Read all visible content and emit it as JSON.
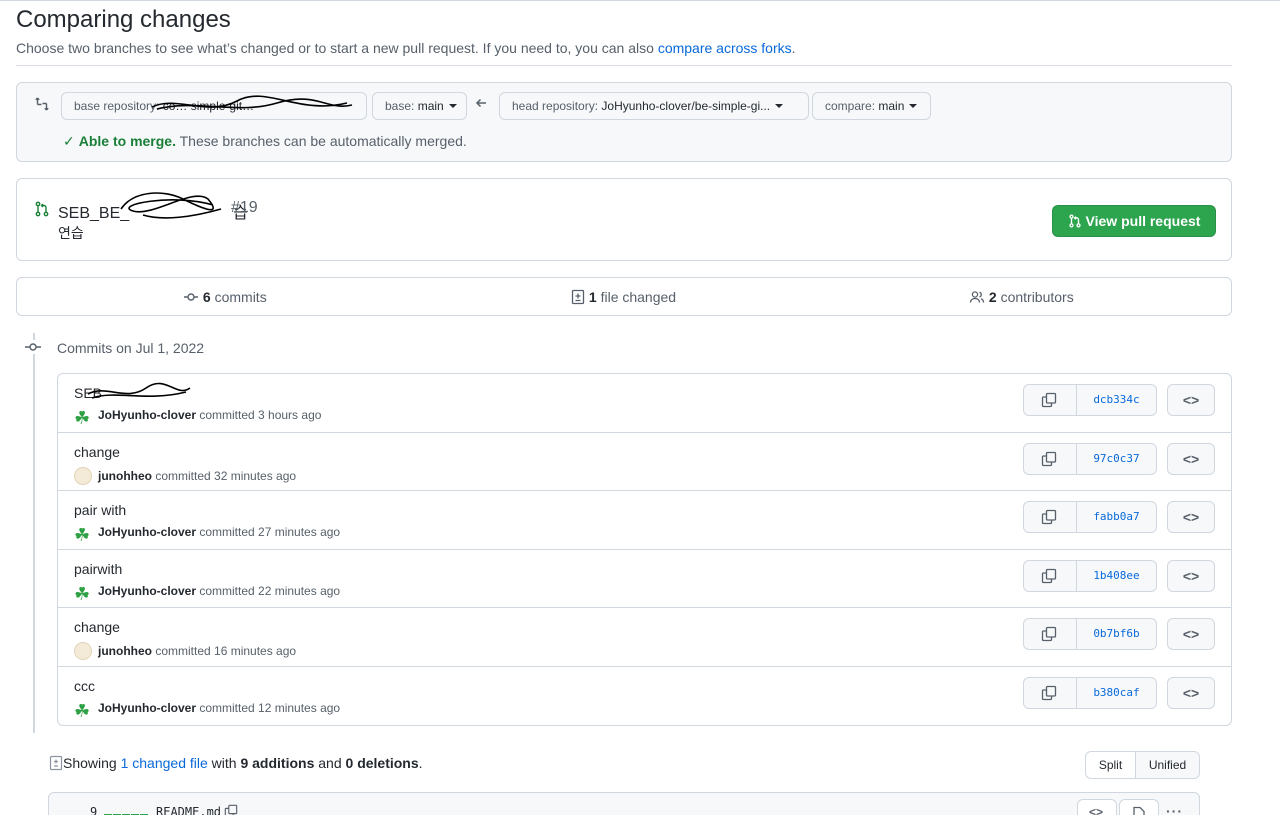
{
  "page": {
    "title": "Comparing changes",
    "subtitle": "Choose two branches to see what’s changed or to start a new pull request. If you need to, you can also ",
    "subtitle_link": "compare across forks",
    "subtitle_end": "."
  },
  "range": {
    "base_repo_label": "base repository: ",
    "base_repo_value": "co… simple-git…",
    "base_label": "base: ",
    "base_value": "main",
    "head_repo_label": "head repository: ",
    "head_repo_value": "JoHyunho-clover/be-simple-gi...",
    "compare_label": "compare: ",
    "compare_value": "main",
    "merge_ok": "Able to merge.",
    "merge_text": " These branches can be automatically merged."
  },
  "pr": {
    "title": "SEB_BE_",
    "title_suffix": "습",
    "number": "#19",
    "description": "연습",
    "view_button": "View pull request"
  },
  "stats": {
    "commits_count": "6",
    "commits_label": " commits",
    "files_count": "1",
    "files_label": " file changed",
    "contributors_count": "2",
    "contributors_label": " contributors"
  },
  "timeline": {
    "date_label": "Commits on Jul 1, 2022"
  },
  "commits": [
    {
      "message": "SEB",
      "author": "JoHyunho-clover",
      "avatar": "clover-icon",
      "verb": " committed ",
      "time": "3 hours ago",
      "sha": "dcb334c"
    },
    {
      "message": "change",
      "author": "junohheo",
      "avatar": "default-avatar",
      "verb": " committed ",
      "time": "32 minutes ago",
      "sha": "97c0c37"
    },
    {
      "message": "pair with",
      "author": "JoHyunho-clover",
      "avatar": "clover-icon",
      "verb": " committed ",
      "time": "27 minutes ago",
      "sha": "fabb0a7"
    },
    {
      "message": "pairwith",
      "author": "JoHyunho-clover",
      "avatar": "clover-icon",
      "verb": " committed ",
      "time": "22 minutes ago",
      "sha": "1b408ee"
    },
    {
      "message": "change",
      "author": "junohheo",
      "avatar": "default-avatar",
      "verb": " committed ",
      "time": "16 minutes ago",
      "sha": "0b7bf6b"
    },
    {
      "message": "ccc",
      "author": "JoHyunho-clover",
      "avatar": "clover-icon",
      "verb": " committed ",
      "time": "12 minutes ago",
      "sha": "b380caf"
    }
  ],
  "files_summary": {
    "prefix": "Showing ",
    "changed_link": "1 changed file",
    "with": " with ",
    "additions": "9 additions",
    "and": " and ",
    "deletions": "0 deletions",
    "end": "."
  },
  "view_toggle": {
    "split": "Split",
    "unified": "Unified"
  },
  "file": {
    "count": "9",
    "name": "README.md"
  },
  "colors": {
    "accent": "#0969da",
    "success": "#2da44e",
    "border": "#d0d7de"
  }
}
